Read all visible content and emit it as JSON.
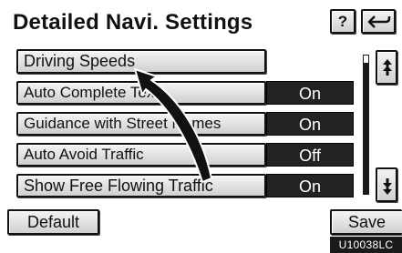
{
  "header": {
    "title": "Detailed Navi. Settings",
    "help_label": "?",
    "back_icon": "return-arrow-icon"
  },
  "settings": [
    {
      "label": "Driving Speeds",
      "value": null
    },
    {
      "label": "Auto Complete Text",
      "value": "On"
    },
    {
      "label": "Guidance with Street Names",
      "value": "On"
    },
    {
      "label": "Auto Avoid Traffic",
      "value": "Off"
    },
    {
      "label": "Show Free Flowing Traffic",
      "value": "On"
    }
  ],
  "scroll": {
    "up_icon": "scroll-up-icon",
    "down_icon": "scroll-down-icon"
  },
  "footer": {
    "default_label": "Default",
    "save_label": "Save"
  },
  "figure_code": "U10038LC",
  "colors": {
    "background": "#ffffff",
    "value_fill": "#222222",
    "value_text": "#ffffff",
    "button_face": "#e4e4e4"
  }
}
